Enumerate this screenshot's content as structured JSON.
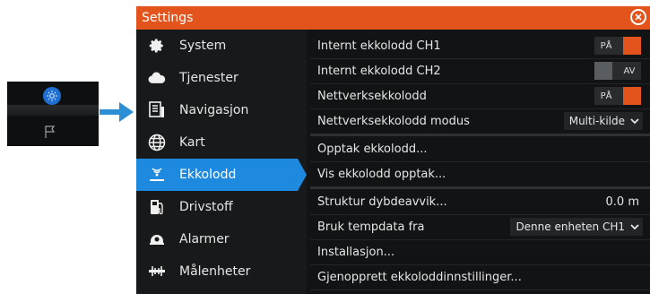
{
  "window": {
    "title": "Settings"
  },
  "sidebar": {
    "items": [
      {
        "label": "System",
        "icon": "gear-icon"
      },
      {
        "label": "Tjenester",
        "icon": "cloud-icon"
      },
      {
        "label": "Navigasjon",
        "icon": "navigation-icon"
      },
      {
        "label": "Kart",
        "icon": "globe-icon"
      },
      {
        "label": "Ekkolodd",
        "icon": "sonar-icon",
        "active": true
      },
      {
        "label": "Drivstoff",
        "icon": "fuel-icon"
      },
      {
        "label": "Alarmer",
        "icon": "alarm-icon"
      },
      {
        "label": "Målenheter",
        "icon": "units-icon"
      }
    ]
  },
  "settings": {
    "internal_ch1": {
      "label": "Internt ekkolodd CH1",
      "state": "PÅ"
    },
    "internal_ch2": {
      "label": "Internt ekkolodd CH2",
      "state": "AV"
    },
    "network_sonar": {
      "label": "Nettverksekkolodd",
      "state": "PÅ"
    },
    "network_mode": {
      "label": "Nettverksekkolodd modus",
      "value": "Multi-kilde"
    },
    "record": {
      "label": "Opptak ekkolodd..."
    },
    "view_record": {
      "label": "Vis ekkolodd opptak..."
    },
    "depth_offset": {
      "label": "Struktur dybdeavvik...",
      "value": "0.0 m"
    },
    "temp_source": {
      "label": "Bruk tempdata fra",
      "value": "Denne enheten CH1"
    },
    "install": {
      "label": "Installasjon..."
    },
    "restore": {
      "label": "Gjenopprett ekkoloddinnstillinger..."
    }
  },
  "colors": {
    "accent": "#e2541c",
    "selected": "#1d8ae0",
    "arrow": "#2c8fd6"
  }
}
